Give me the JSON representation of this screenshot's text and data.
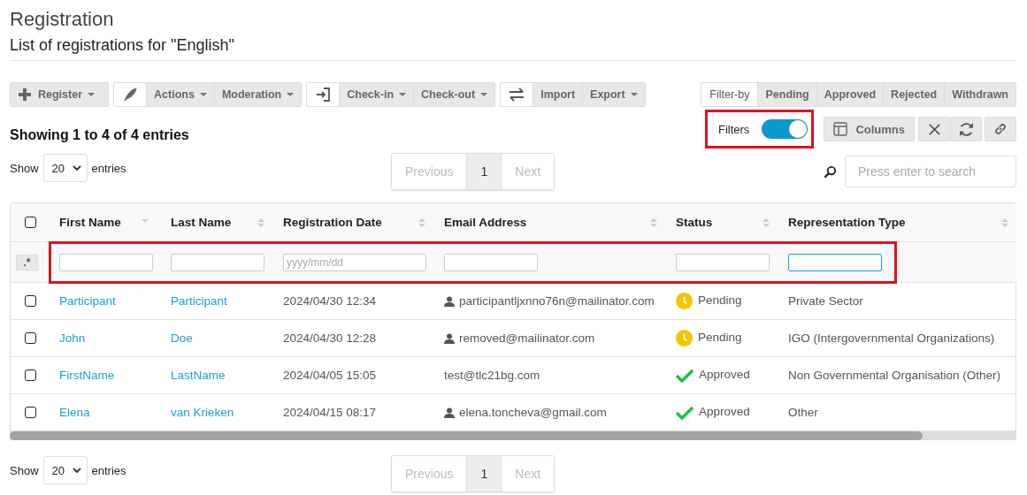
{
  "title": "Registration",
  "subtitle": "List of registrations for \"English\"",
  "toolbar": [
    {
      "buttons": [
        {
          "label": "Register",
          "caret": true
        }
      ]
    },
    {
      "buttons": [
        {
          "label": "Actions",
          "caret": true
        },
        {
          "label": "Moderation",
          "caret": true
        }
      ]
    },
    {
      "buttons": [
        {
          "label": "Check-in",
          "caret": true
        },
        {
          "label": "Check-out",
          "caret": true
        }
      ]
    },
    {
      "buttons": [
        {
          "label": "Import",
          "caret": false
        },
        {
          "label": "Export",
          "caret": true
        }
      ]
    }
  ],
  "filter_by": {
    "label": "Filter-by",
    "options": [
      {
        "label": "Pending",
        "selected": false
      },
      {
        "label": "Approved",
        "selected": false
      },
      {
        "label": "Rejected",
        "selected": false
      },
      {
        "label": "Withdrawn",
        "selected": false
      }
    ]
  },
  "summary": "Showing 1 to 4 of 4 entries",
  "filters_toggle": {
    "label": "Filters",
    "on": true,
    "highlighted": true
  },
  "columns_button": "Columns",
  "length_top": {
    "before": "Show",
    "value": "20",
    "after": "entries"
  },
  "pager_top": {
    "previous": "Previous",
    "page": "1",
    "next": "Next",
    "previous_disabled": true,
    "next_disabled": true
  },
  "search": {
    "placeholder": "Press enter to search"
  },
  "table": {
    "select_all_checked": false,
    "columns": [
      {
        "label": "First Name",
        "sorted_desc": true
      },
      {
        "label": "Last Name",
        "sorted_desc": false
      },
      {
        "label": "Registration Date",
        "sorted_desc": false
      },
      {
        "label": "Email Address",
        "sorted_desc": false
      },
      {
        "label": "Status",
        "sorted_desc": false
      },
      {
        "label": "Representation Type",
        "sorted_desc": false
      }
    ],
    "filter_row": {
      "regex": ".*",
      "highlighted": true,
      "fields": [
        {
          "focused": false
        },
        {
          "focused": false
        },
        {
          "placeholder": "yyyy/mm/dd",
          "focused": false
        },
        {
          "focused": false
        },
        {
          "focused": false
        },
        {
          "focused": true
        }
      ]
    },
    "rows": [
      {
        "checked": false,
        "first": "Participant",
        "last": "Participant",
        "date": "2024/04/30 12:34",
        "user_icon": true,
        "email": "participantljxnno76n@mailinator.com",
        "status": {
          "kind": "pending",
          "label": "Pending"
        },
        "type": "Private Sector"
      },
      {
        "checked": false,
        "first": "John",
        "last": "Doe",
        "date": "2024/04/30 12:28",
        "user_icon": true,
        "email": "removed@mailinator.com",
        "status": {
          "kind": "pending",
          "label": "Pending"
        },
        "type": "IGO (Intergovernmental Organizations)"
      },
      {
        "checked": false,
        "first": "FirstName",
        "last": "LastName",
        "date": "2024/04/05 15:05",
        "user_icon": false,
        "email": "test@tlc21bg.com",
        "status": {
          "kind": "approved",
          "label": "Approved"
        },
        "type": "Non Governmental Organisation (Other)"
      },
      {
        "checked": false,
        "first": "Elena",
        "last": "van Krieken",
        "date": "2024/04/15 08:17",
        "user_icon": true,
        "email": "elena.toncheva@gmail.com",
        "status": {
          "kind": "approved",
          "label": "Approved"
        },
        "type": "Other"
      }
    ]
  },
  "length_bottom": {
    "before": "Show",
    "value": "20",
    "after": "entries"
  },
  "pager_bottom": {
    "previous": "Previous",
    "page": "1",
    "next": "Next",
    "previous_disabled": true,
    "next_disabled": true
  }
}
